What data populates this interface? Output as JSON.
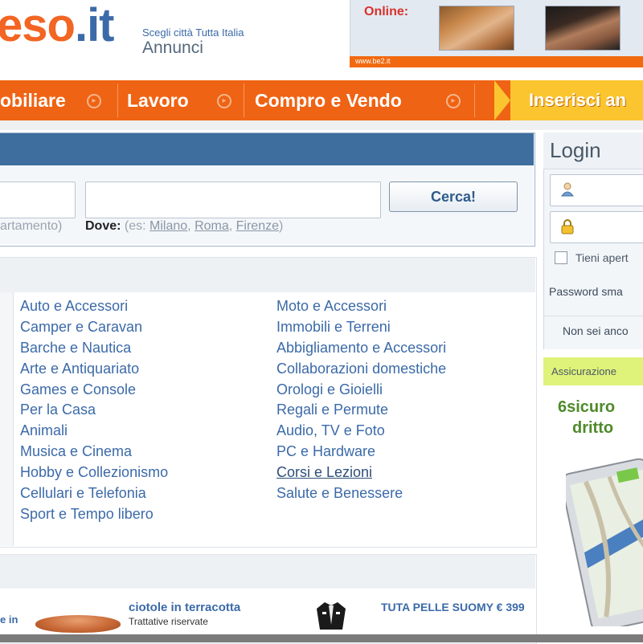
{
  "header": {
    "logo_part1": "eso",
    "logo_part2": ".it",
    "tagline": "Scegli città  Tutta Italia",
    "subtitle": "Annunci",
    "online_label": "Online:",
    "online_url": "www.be2.it"
  },
  "nav": {
    "items": [
      "obiliare",
      "Lavoro",
      "Compro e Vendo"
    ],
    "insert_label": "Inserisci an"
  },
  "search": {
    "button": "Cerca!",
    "hint_left": "artamento)",
    "dove_label": "Dove:",
    "dove_prefix": "(es:",
    "examples": [
      "Milano",
      "Roma",
      "Firenze"
    ],
    "dove_suffix": ")"
  },
  "categories": {
    "col1": [
      "Auto e Accessori",
      "Camper e Caravan",
      "Barche e Nautica",
      "Arte e Antiquariato",
      "Games e Console",
      "Per la Casa",
      "Animali",
      "Musica e Cinema",
      "Hobby e Collezionismo",
      "Cellulari e Telefonia",
      "Sport e Tempo libero"
    ],
    "col2": [
      "Moto e Accessori",
      "Immobili e Terreni",
      "Abbigliamento e Accessori",
      "Collaborazioni domestiche",
      "Orologi e Gioielli",
      "Regali e Permute",
      "Audio, TV e Foto",
      "PC e Hardware",
      "Corsi e Lezioni",
      "Salute e Benessere"
    ]
  },
  "ads": {
    "left_text": "e in",
    "ad1_title": "ciotole in terracotta",
    "ad1_sub": "Trattative riservate",
    "ad2_title": "TUTA PELLE SUOMY € 399"
  },
  "login": {
    "title": "Login",
    "remember": "Tieni apert",
    "forgot": "Password sma",
    "register": "Non sei anco"
  },
  "right_ad": {
    "insurance": "Assicurazione",
    "line1": "6sicuro",
    "line2": "dritto"
  }
}
